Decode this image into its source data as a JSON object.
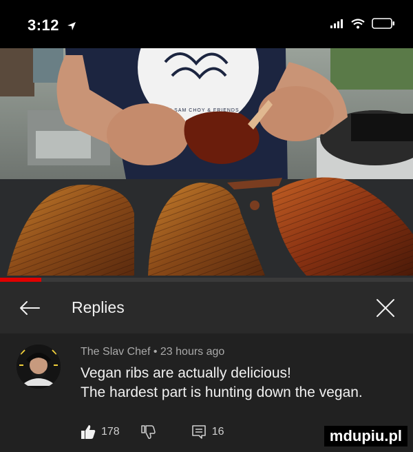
{
  "status_bar": {
    "time": "3:12",
    "icons": [
      "location-arrow-icon",
      "signal-bars-icon",
      "wifi-icon",
      "battery-icon"
    ]
  },
  "video": {
    "shirt_logo_text": "WITH SAM CHOY & FRIENDS",
    "progress_fraction": 0.1
  },
  "replies": {
    "title": "Replies",
    "icons": {
      "back": "arrow-left-icon",
      "close": "close-icon"
    }
  },
  "comment": {
    "author": "The Slav Chef",
    "separator": "•",
    "timestamp": "23 hours ago",
    "lines": [
      "Vegan ribs are actually delicious!",
      "The hardest part is hunting down the vegan."
    ],
    "likes": "178",
    "replies_count": "16",
    "icons": {
      "like": "thumbs-up-icon",
      "dislike": "thumbs-down-icon",
      "reply": "comment-icon"
    }
  },
  "watermark": "mdupiu.pl",
  "colors": {
    "panel": "#212121",
    "header": "#2a2a2a",
    "progress": "#e00000"
  }
}
